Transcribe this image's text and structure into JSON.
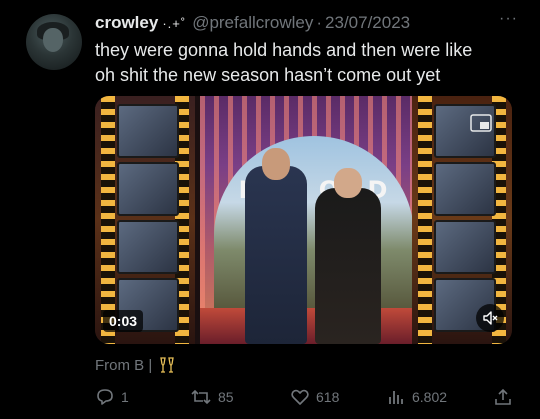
{
  "tweet": {
    "display_name": "crowley",
    "name_decoration": "·.+˚",
    "handle": "@prefallcrowley",
    "separator": "·",
    "date": "23/07/2023",
    "more_label": "···",
    "text_line1": "they were gonna hold hands and then were like",
    "text_line2": "oh shit the new season hasn’t come out yet"
  },
  "media": {
    "sign_text": "HOL   OOD",
    "video_time": "0:03"
  },
  "source": {
    "label": "From B |"
  },
  "actions": {
    "replies": "1",
    "retweets": "85",
    "likes": "618",
    "views": "6.802"
  },
  "colors": {
    "background": "#000000",
    "text": "#e7e9ea",
    "muted": "#71767b"
  }
}
